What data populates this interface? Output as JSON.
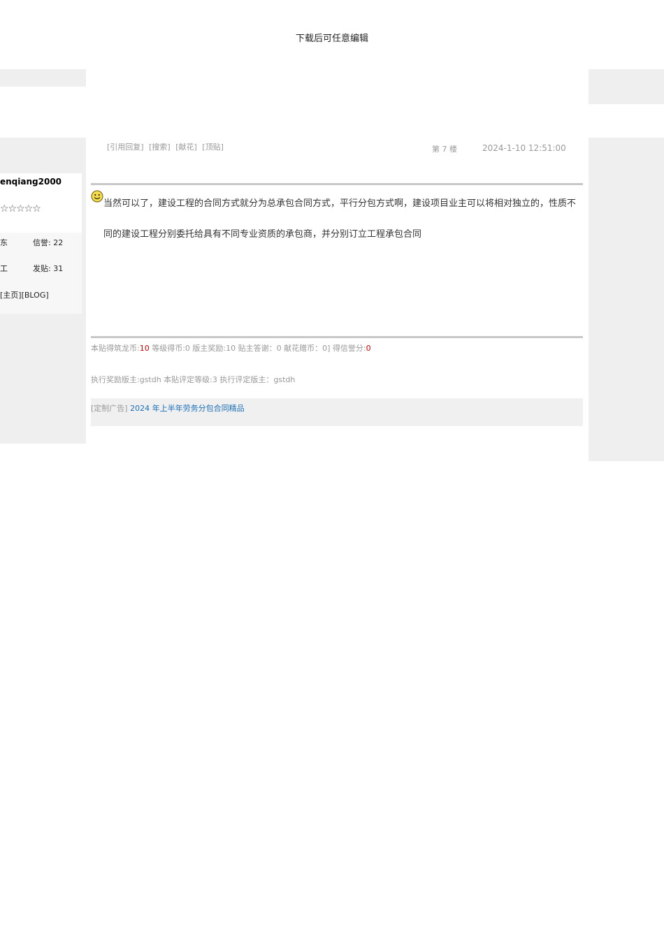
{
  "header": {
    "text": "下载后可任意编辑"
  },
  "post": {
    "toolbar": [
      "[引用回复]",
      "[搜索]",
      "[献花]",
      "[顶贴]"
    ],
    "floor": "第 7 楼",
    "datetime": "2024-1-10 12:51:00",
    "content": "当然可以了，建设工程的合同方式就分为总承包合同方式，平行分包方式啊，建设项目业主可以将相对独立的，性质不同的建设工程分别委托给具有不同专业资质的承包商，并分别订立工程承包合同"
  },
  "user": {
    "name": "enqiang2000",
    "stars": "☆☆☆☆☆",
    "stat1_label": "东",
    "reputation": "信誉: 22",
    "stat2_label": "工",
    "posts": "发贴: 31",
    "link_home": "[主页]",
    "link_blog": "[BLOG]"
  },
  "reward": {
    "coin_label": "本贴得筑龙币:",
    "coin_value": "10",
    "rest": " 等级得币:0 版主奖励:10 贴主答谢：0 献花赠币：0] 得信誉分:",
    "rep_value": "0"
  },
  "exec": {
    "text": "执行奖励版主:gstdh  本贴评定等级:3 执行评定版主：gstdh"
  },
  "ad": {
    "label": "[定制广告]",
    "link": "2024 年上半年劳务分包合同精品"
  },
  "colors": {
    "panel_gray": "#efefef",
    "rule": "#c8c8c8",
    "link_blue": "#1a6fb8",
    "highlight_red": "#cc0000"
  }
}
